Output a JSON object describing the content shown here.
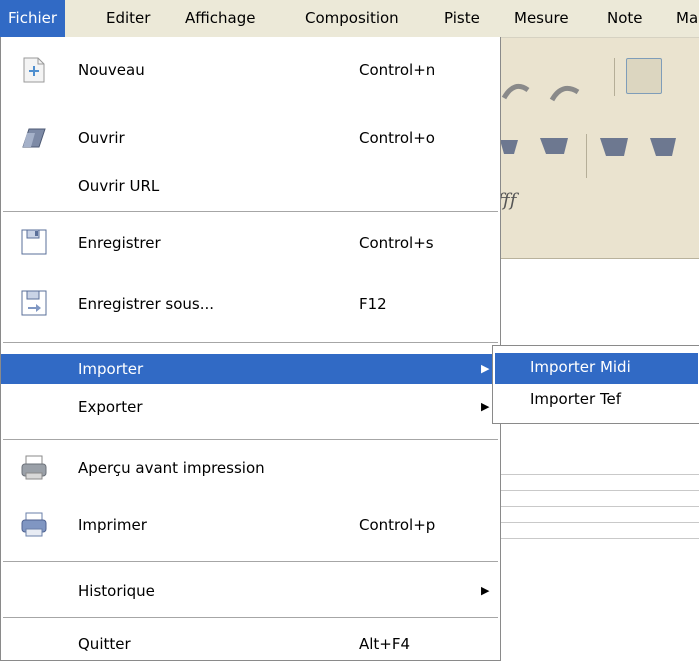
{
  "menubar": {
    "items": [
      "Fichier",
      "Editer",
      "Affichage",
      "Composition",
      "Piste",
      "Mesure",
      "Note",
      "Ma"
    ]
  },
  "background": {
    "dynamics_label": "fff"
  },
  "menu": {
    "nouveau": {
      "label": "Nouveau",
      "shortcut": "Control+n",
      "icon": "new-file-icon"
    },
    "ouvrir": {
      "label": "Ouvrir",
      "shortcut": "Control+o",
      "icon": "folder-icon"
    },
    "ouvrir_url": {
      "label": "Ouvrir URL"
    },
    "enregistrer": {
      "label": "Enregistrer",
      "shortcut": "Control+s",
      "icon": "floppy-disk-icon"
    },
    "enregistrer_sous": {
      "label": "Enregistrer sous...",
      "shortcut": "F12",
      "icon": "save-as-icon"
    },
    "importer": {
      "label": "Importer",
      "arrow": "▶"
    },
    "exporter": {
      "label": "Exporter",
      "arrow": "▶"
    },
    "apercu": {
      "label": "Aperçu avant impression",
      "icon": "print-preview-icon"
    },
    "imprimer": {
      "label": "Imprimer",
      "shortcut": "Control+p",
      "icon": "printer-icon"
    },
    "historique": {
      "label": "Historique",
      "arrow": "▶"
    },
    "quitter": {
      "label": "Quitter",
      "shortcut": "Alt+F4"
    }
  },
  "submenu": {
    "importer_midi": "Importer Midi",
    "importer_tef": "Importer Tef"
  },
  "colors": {
    "highlight": "#316ac5",
    "menubar_bg": "#ece9d8",
    "toolbar_bg": "#eae3cf"
  }
}
